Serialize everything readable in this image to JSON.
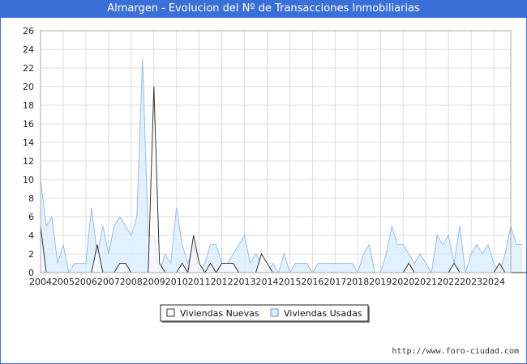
{
  "title": "Almargen - Evolucion del Nº de Transacciones Inmobiliarias",
  "footer": "http://www.foro-ciudad.com",
  "colors": {
    "header": "#3a6fd8",
    "nuevas_fill": "#ffffff",
    "nuevas_line": "#333333",
    "usadas_fill": "#ddeeff",
    "usadas_line": "#9bbde6"
  },
  "chart_data": {
    "type": "area",
    "ylim": [
      0,
      26
    ],
    "yticks": [
      0,
      2,
      4,
      6,
      8,
      10,
      12,
      14,
      16,
      18,
      20,
      22,
      24,
      26
    ],
    "xlim": [
      2004,
      2024.75
    ],
    "xticks": [
      "2004",
      "2005",
      "2006",
      "2007",
      "2008",
      "2009",
      "2010",
      "2011",
      "2012",
      "2013",
      "2014",
      "2015",
      "2016",
      "2017",
      "2018",
      "2019",
      "2020",
      "2021",
      "2022",
      "2023",
      "2024"
    ],
    "legend": [
      "Viviendas Nuevas",
      "Viviendas Usadas"
    ],
    "series": [
      {
        "name": "Viviendas Nuevas",
        "start": 2004,
        "step": 0.25,
        "values": [
          5,
          0,
          0,
          0,
          0,
          0,
          0,
          0,
          0,
          0,
          3,
          0,
          0,
          0,
          1,
          1,
          0,
          0,
          0,
          0,
          20,
          1,
          0,
          0,
          0,
          1,
          0,
          4,
          1,
          0,
          1,
          0,
          1,
          1,
          1,
          0,
          0,
          0,
          0,
          2,
          1,
          0,
          0,
          0,
          0,
          0,
          0,
          0,
          0,
          0,
          0,
          0,
          0,
          0,
          0,
          0,
          0,
          0,
          0,
          0,
          0,
          0,
          0,
          0,
          0,
          1,
          0,
          0,
          0,
          0,
          0,
          0,
          0,
          1,
          0,
          0,
          0,
          0,
          0,
          0,
          0,
          1,
          0,
          0,
          0,
          0,
          0,
          0
        ]
      },
      {
        "name": "Viviendas Usadas",
        "start": 2004,
        "step": 0.25,
        "values": [
          10,
          5,
          6,
          1,
          3,
          0,
          1,
          1,
          1,
          7,
          2,
          5,
          2,
          5,
          6,
          5,
          4,
          6,
          23,
          4,
          4,
          0,
          2,
          1,
          7,
          3,
          1,
          3,
          0,
          1,
          3,
          3,
          1,
          1,
          2,
          3,
          4,
          1,
          2,
          1,
          0,
          1,
          0,
          2,
          0,
          1,
          1,
          1,
          0,
          1,
          1,
          1,
          1,
          1,
          1,
          1,
          0,
          2,
          3,
          0,
          0,
          2,
          5,
          3,
          3,
          2,
          1,
          2,
          1,
          0,
          4,
          3,
          4,
          1,
          5,
          0,
          2,
          3,
          2,
          3,
          1,
          0,
          2,
          5,
          3,
          3
        ]
      }
    ]
  }
}
